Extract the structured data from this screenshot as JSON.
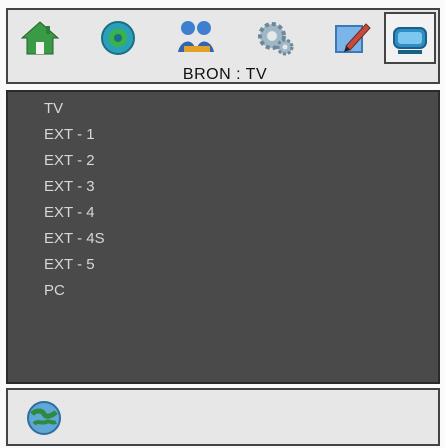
{
  "header": {
    "title": "BRON : TV",
    "icons": [
      "home-icon",
      "sound-icon",
      "picture-icon",
      "settings-icon",
      "edit-icon",
      "source-icon"
    ],
    "selected_icon": "source-icon"
  },
  "menu": {
    "items": [
      {
        "label": "TV"
      },
      {
        "label": "EXT - 1"
      },
      {
        "label": "EXT - 2"
      },
      {
        "label": "EXT - 3"
      },
      {
        "label": "EXT - 4"
      },
      {
        "label": "EXT - 4S"
      },
      {
        "label": "EXT - 5"
      },
      {
        "label": "PC"
      }
    ]
  },
  "footer": {
    "icon": "globe-icon"
  },
  "colors": {
    "panel_bg": "#4a4a4a",
    "bar_bg": "#e7e7e7",
    "menu_text": "#d7d7d7"
  }
}
